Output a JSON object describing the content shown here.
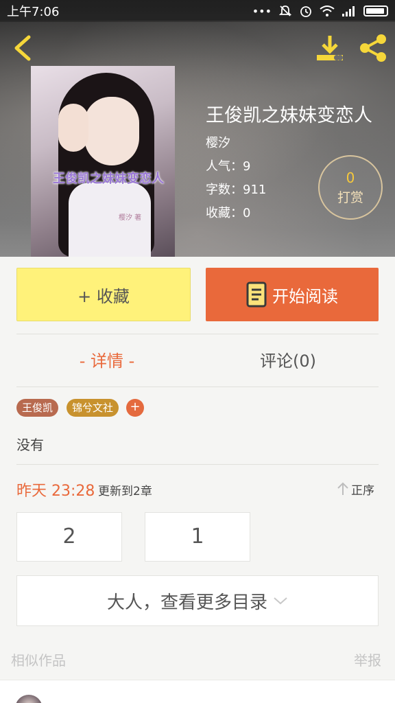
{
  "status_bar": {
    "time": "上午7:06",
    "icons": [
      "dots-icon",
      "mute-icon",
      "alarm-icon",
      "wifi-icon",
      "signal-icon",
      "battery-icon"
    ]
  },
  "toolbar": {
    "back_icon": "chevron-left-icon",
    "download_icon": "download-icon",
    "share_icon": "share-icon"
  },
  "book": {
    "cover_title": "王俊凯之妹妹变恋人",
    "cover_author": "樱汐 著",
    "title": "王俊凯之妹妹变恋人",
    "author": "樱汐",
    "popularity_label": "人气：9",
    "word_count_label": "字数：911",
    "favorites_label": "收藏：0"
  },
  "reward": {
    "count": "0",
    "label": "打赏"
  },
  "actions": {
    "favorite_label": "+ 收藏",
    "read_label": "开始阅读"
  },
  "tabs": {
    "detail": "- 详情 -",
    "comments": "评论(0)"
  },
  "tags": [
    "王俊凯",
    "锦兮文社"
  ],
  "tag_add": "+",
  "description": "没有",
  "update": {
    "time": "昨天 23:28",
    "text": "更新到2章",
    "sort_label": "正序"
  },
  "chapters": [
    "2",
    "1"
  ],
  "more_toc_label": "大人，查看更多目录",
  "similar_label": "相似作品",
  "report_label": "举报",
  "colors": {
    "accent": "#e9693b",
    "favorite_bg": "#fff27a",
    "reward_border": "#d9c59e",
    "reward_count": "#f7c93b"
  }
}
